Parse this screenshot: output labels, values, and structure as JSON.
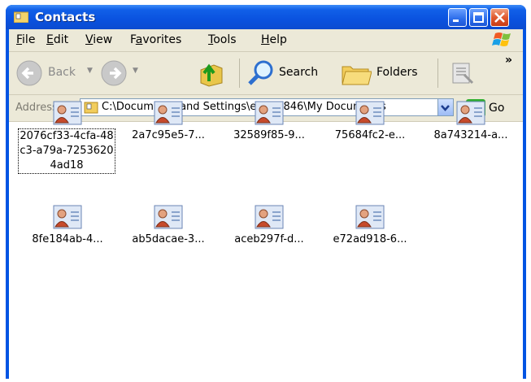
{
  "window": {
    "title": "Contacts"
  },
  "menu": [
    {
      "pre": "",
      "u": "F",
      "post": "ile"
    },
    {
      "pre": "",
      "u": "E",
      "post": "dit"
    },
    {
      "pre": "",
      "u": "V",
      "post": "iew"
    },
    {
      "pre": "F",
      "u": "a",
      "post": "vorites"
    },
    {
      "pre": "",
      "u": "T",
      "post": "ools"
    },
    {
      "pre": "",
      "u": "H",
      "post": "elp"
    }
  ],
  "toolbar": {
    "back_label": "Back",
    "search_label": "Search",
    "folders_label": "Folders",
    "overflow": "»"
  },
  "address": {
    "label": "Address",
    "value": "C:\\Documents and Settings\\e5002846\\My Documents",
    "go_label": "Go"
  },
  "items": [
    {
      "name": "2076cf33-4cfa-48c3-a79a-72536204ad18",
      "selected": true
    },
    {
      "name": "2a7c95e5-7..."
    },
    {
      "name": "32589f85-9..."
    },
    {
      "name": "75684fc2-e..."
    },
    {
      "name": "8a743214-a..."
    },
    {
      "name": "8fe184ab-4..."
    },
    {
      "name": "ab5dacae-3..."
    },
    {
      "name": "aceb297f-d..."
    },
    {
      "name": "e72ad918-6..."
    }
  ]
}
